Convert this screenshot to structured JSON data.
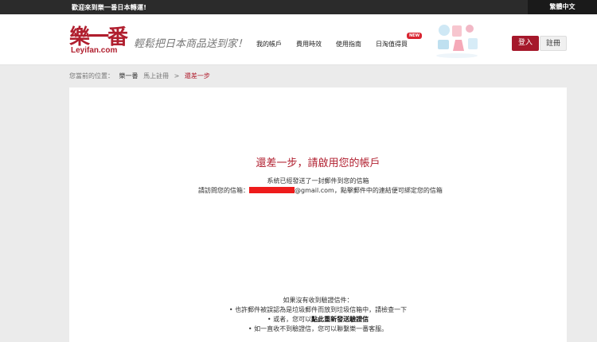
{
  "topbar": {
    "welcome": "歡迎來到樂一番日本轉運!",
    "language": "繁體中文"
  },
  "header": {
    "logo_cn": "樂一番",
    "logo_en": "Leyifan.com",
    "slogan": "輕鬆把日本商品送到家！",
    "nav": [
      "我的帳戶",
      "費用時效",
      "使用指南",
      "日淘值得買"
    ],
    "new_badge": "NEW",
    "login_label": "登入",
    "register_label": "註冊"
  },
  "breadcrumb": {
    "prefix": "您當前的位置：",
    "home": "樂一番",
    "parent": "馬上註冊",
    "separator": ">",
    "current": "還差一步"
  },
  "main": {
    "title": "還差一步，請啟用您的帳戶",
    "sent_msg": "系統已經發送了一封郵件到您的信箱",
    "visit_prefix": "請訪問您的信箱：",
    "email_domain": "@gmail.com",
    "visit_suffix": "，點擊郵件中的連結便可綁定您的信箱"
  },
  "help": {
    "heading": "如果沒有收到驗證信件：",
    "tip1": "• 也許郵件被誤認為是垃圾郵件而放到垃圾信箱中，請檢查一下",
    "tip2_prefix": "• 或者，您可以",
    "tip2_link": "點此重新發送驗證信",
    "tip3": "• 如一直收不到驗證信，您可以聯繫樂一番客服。"
  },
  "colors": {
    "brand": "#b01e2e",
    "topbar": "#2b2b2b",
    "redaction": "#ee1b1b"
  }
}
